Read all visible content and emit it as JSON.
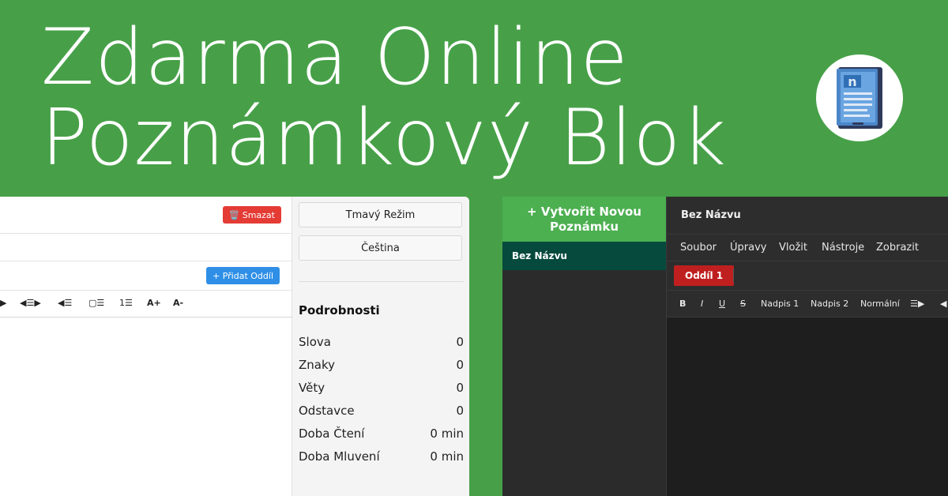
{
  "hero": {
    "line1": "Zdarma Online",
    "line2": "Poznámkový Blok"
  },
  "light_app": {
    "delete_label": "🗑️ Smazat",
    "add_section_label": "+ Přidat Oddíl",
    "format_buttons": [
      "▶",
      "◀☰▶",
      "◀☰",
      "▢☰",
      "1☰",
      "A+",
      "A-"
    ],
    "side": {
      "dark_mode_label": "Tmavý Režim",
      "language_label": "Čeština",
      "details_title": "Podrobnosti",
      "stats": [
        {
          "label": "Slova",
          "value": "0"
        },
        {
          "label": "Znaky",
          "value": "0"
        },
        {
          "label": "Věty",
          "value": "0"
        },
        {
          "label": "Odstavce",
          "value": "0"
        },
        {
          "label": "Doba Čtení",
          "value": "0 min"
        },
        {
          "label": "Doba Mluvení",
          "value": "0 min"
        }
      ]
    }
  },
  "dark_app": {
    "new_note_label": "+ Vytvořit Novou Poznámku",
    "note_item": "Bez Názvu",
    "title": "Bez Názvu",
    "menu": [
      "Soubor",
      "Úpravy",
      "Vložit",
      "Nástroje",
      "Zobrazit"
    ],
    "section_tab": "Oddíl 1",
    "format_buttons": [
      "B",
      "I",
      "U",
      "S",
      "Nadpis 1",
      "Nadpis 2",
      "Normální",
      "☰▶",
      "◀"
    ]
  },
  "colors": {
    "background": "#47a048",
    "delete": "#e43b35",
    "add_section": "#2f8fe6",
    "new_note": "#4caf50",
    "note_selected": "#064a3d",
    "section_tab": "#c01f1f"
  },
  "icons": [
    "notebook-logo-icon",
    "trash-icon"
  ]
}
